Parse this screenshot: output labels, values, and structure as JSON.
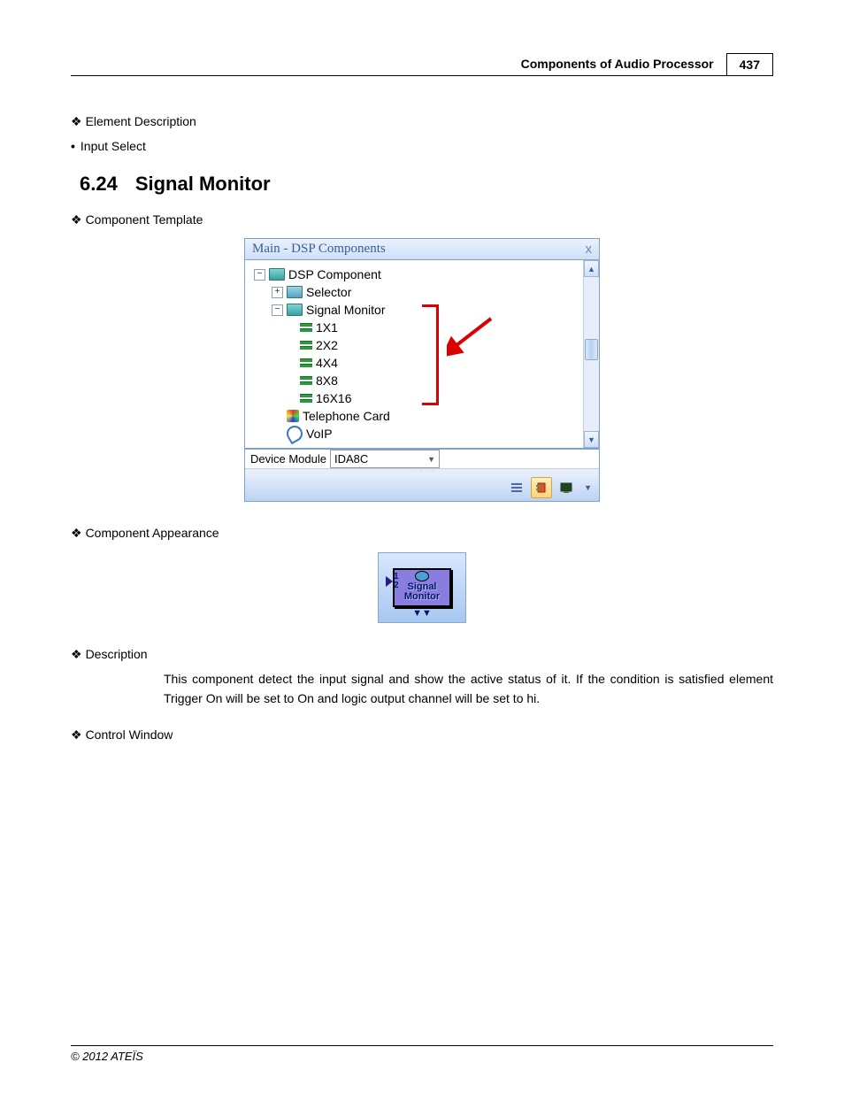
{
  "header": {
    "title": "Components of Audio Processor",
    "page": "437"
  },
  "top": {
    "element_description": "Element Description",
    "input_select": "Input Select"
  },
  "section": {
    "number": "6.24",
    "title": "Signal Monitor"
  },
  "labels": {
    "component_template": "Component Template",
    "component_appearance": "Component Appearance",
    "description": "Description",
    "control_window": "Control Window"
  },
  "dsp": {
    "window_title": "Main - DSP Components",
    "close": "x",
    "tree": {
      "root": "DSP Component",
      "selector": "Selector",
      "signal_monitor": "Signal Monitor",
      "items": [
        "1X1",
        "2X2",
        "4X4",
        "8X8",
        "16X16"
      ],
      "telephone": "Telephone Card",
      "voip": "VoIP"
    },
    "device_label": "Device Module",
    "device_value": "IDA8C"
  },
  "appearance": {
    "line1": "Signal",
    "line2": "Monitor",
    "ports": [
      "1",
      "2"
    ]
  },
  "description_text": "This component detect the input signal and show the active status of it. If the condition is satisfied element Trigger On will be set to On and logic output channel will be set to hi.",
  "footer": "© 2012 ATEÏS"
}
